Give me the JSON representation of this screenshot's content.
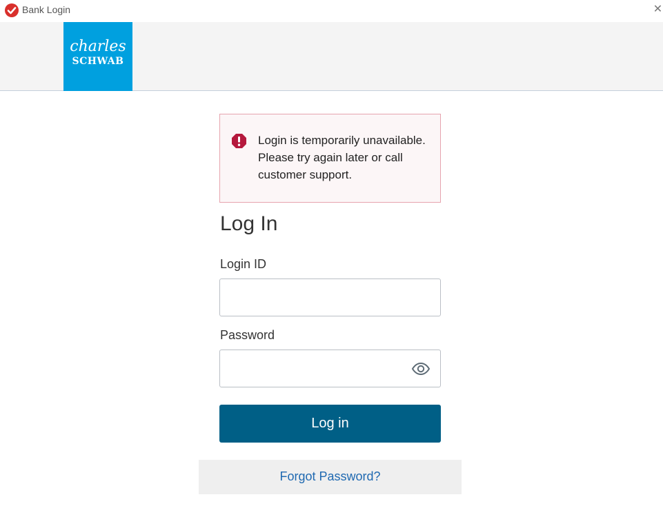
{
  "window": {
    "title": "Bank Login",
    "close_symbol": "✕",
    "app_icon": "checkmark-icon"
  },
  "logo": {
    "line1": "charles",
    "line2": "SCHWAB",
    "brand_color": "#00a0df"
  },
  "alert": {
    "icon": "exclamation-icon",
    "message": "Login is temporarily unavailable. Please try again later or call customer support.",
    "icon_color": "#b5193d"
  },
  "form": {
    "heading": "Log In",
    "login_id_label": "Login ID",
    "login_id_value": "",
    "password_label": "Password",
    "password_value": "",
    "show_password_icon": "eye-icon",
    "submit_label": "Log in",
    "submit_color": "#005f86",
    "forgot_link": "Forgot Password?"
  }
}
